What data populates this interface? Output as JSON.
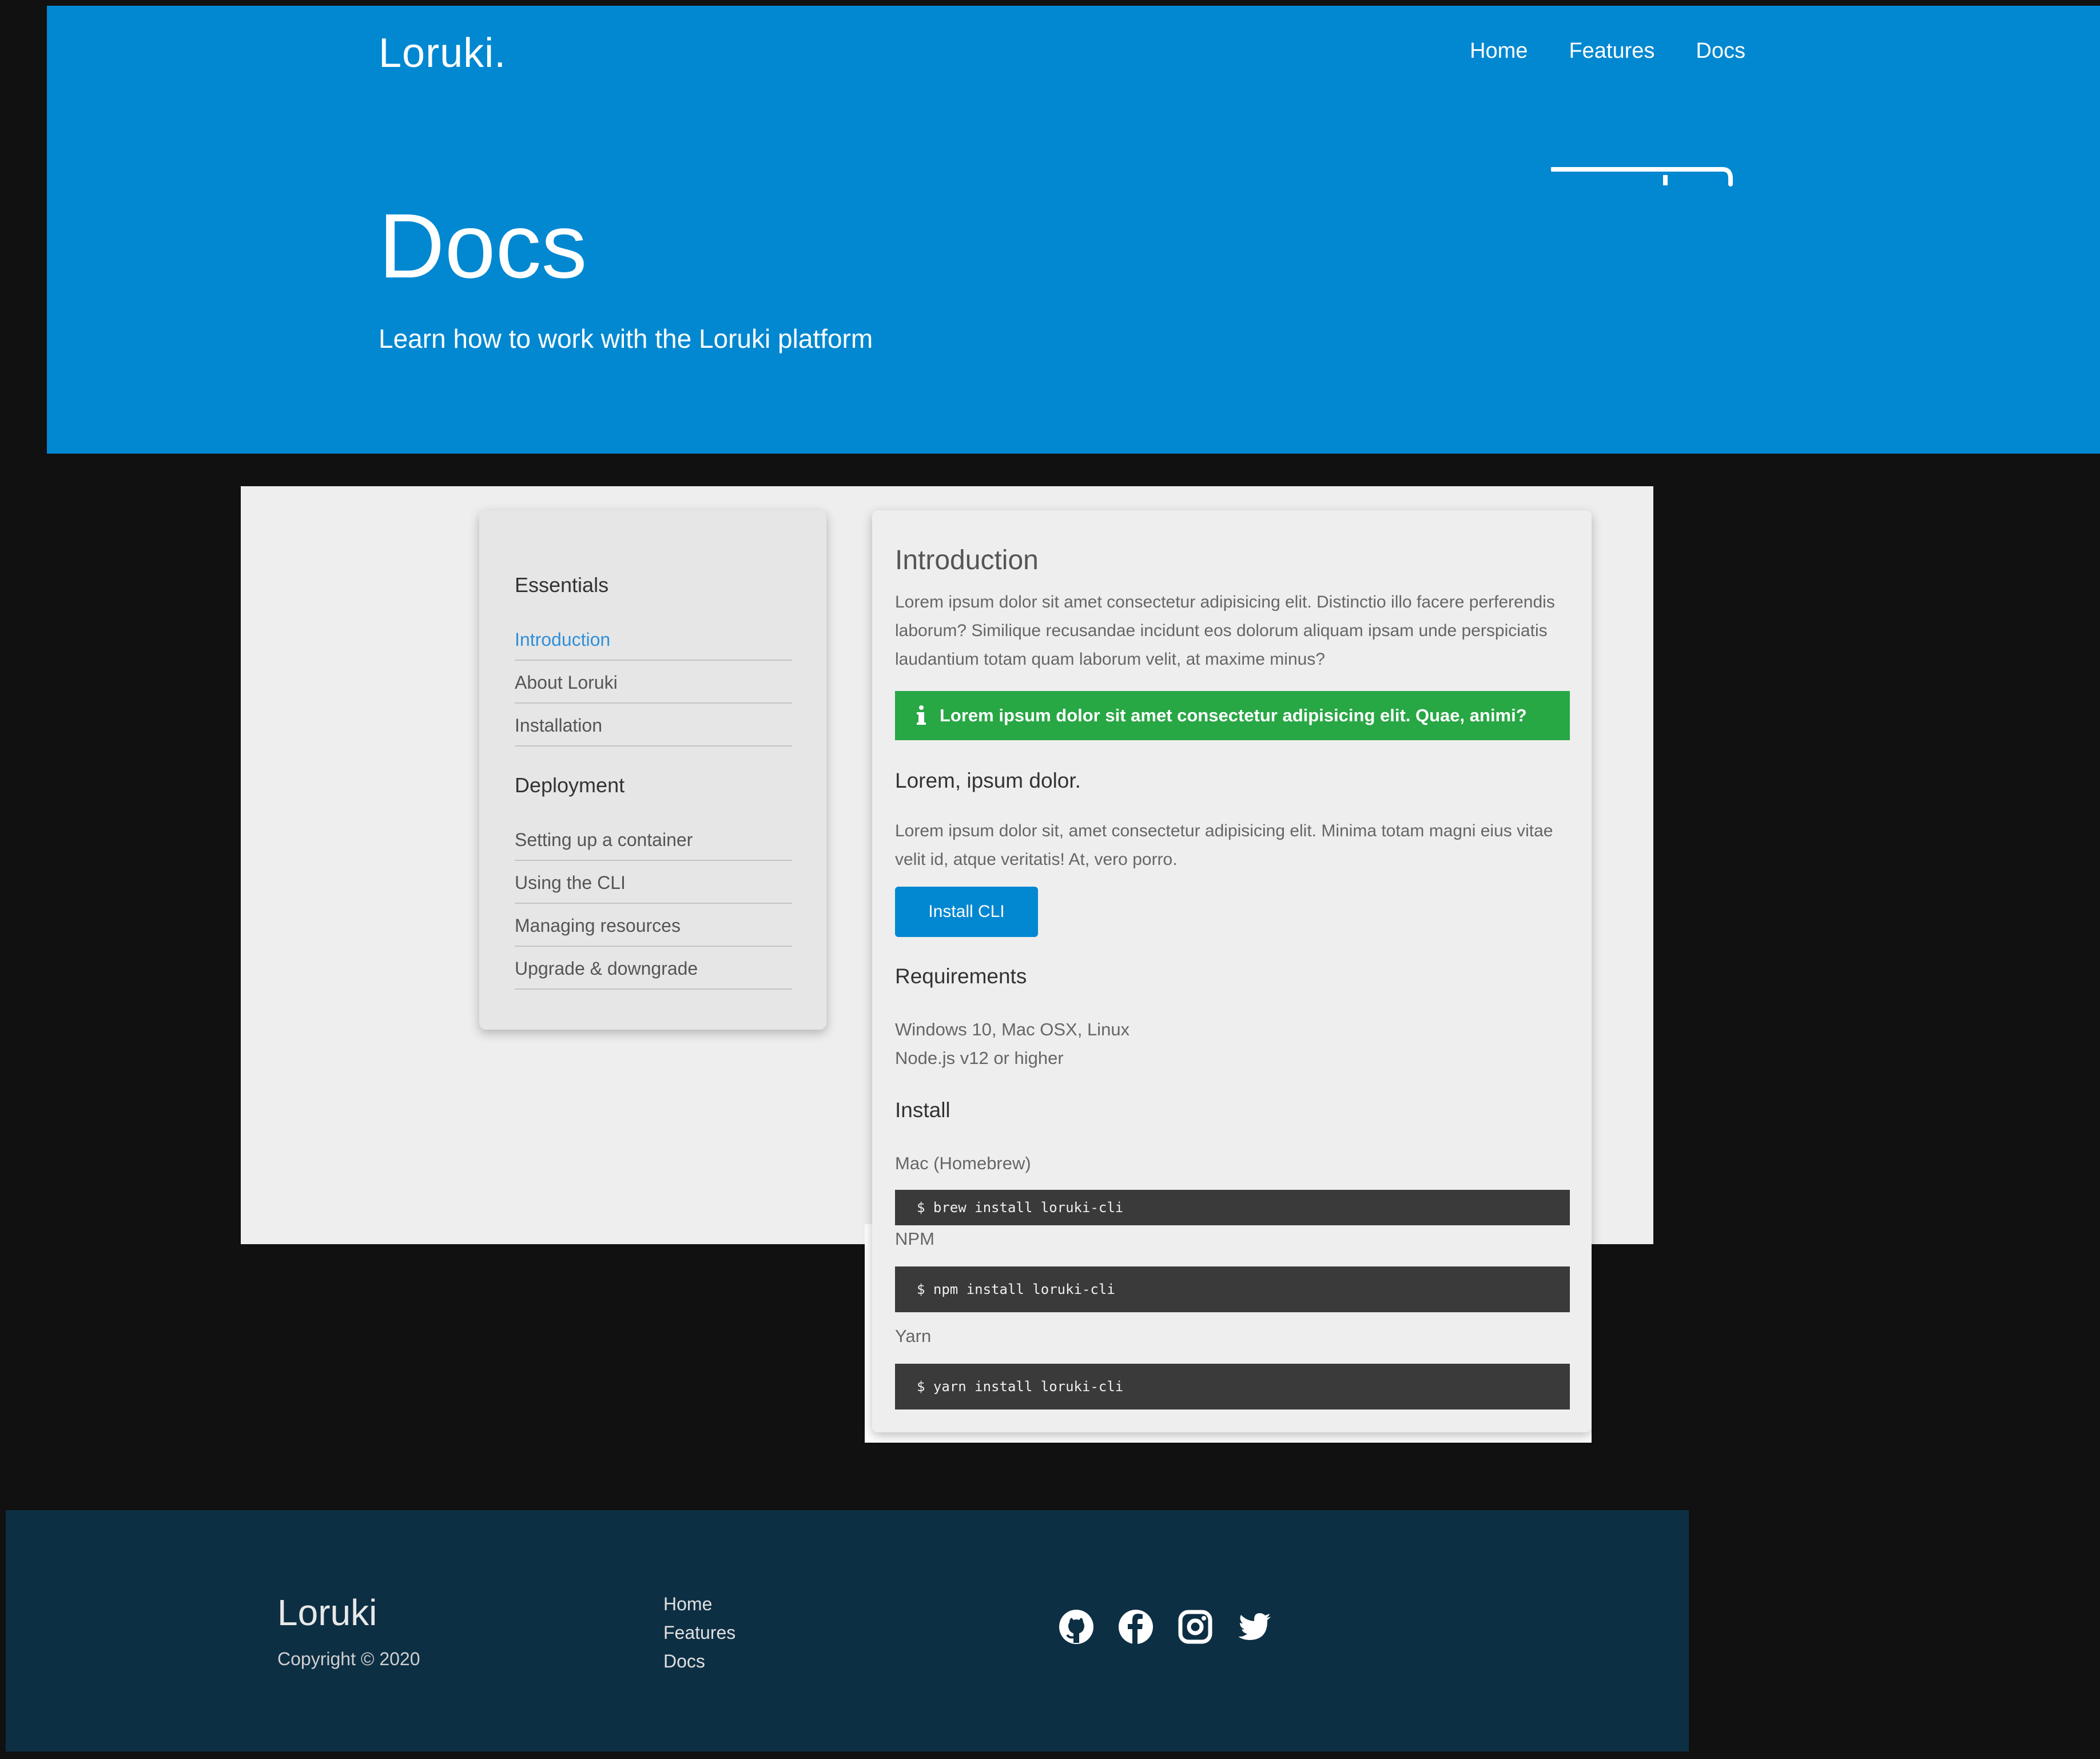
{
  "header": {
    "logo": "Loruki.",
    "nav": [
      "Home",
      "Features",
      "Docs"
    ]
  },
  "hero": {
    "title": "Docs",
    "subtitle": "Learn how to work with the Loruki platform"
  },
  "sidebar": {
    "sections": [
      {
        "heading": "Essentials",
        "items": [
          "Introduction",
          "About Loruki",
          "Installation"
        ]
      },
      {
        "heading": "Deployment",
        "items": [
          "Setting up a container",
          "Using the CLI",
          "Managing resources",
          "Upgrade & downgrade"
        ]
      }
    ],
    "active_item": "Introduction"
  },
  "content": {
    "title": "Introduction",
    "intro_lines": [
      "Lorem ipsum dolor sit amet consectetur adipisicing elit. Distinctio illo facere perferendis",
      "laborum? Similique recusandae incidunt eos dolorum aliquam ipsam unde perspiciatis",
      "laudantium totam quam laborum velit, at maxime minus?"
    ],
    "alert": "Lorem ipsum dolor sit amet consectetur adipisicing elit. Quae, animi?",
    "subheading": "Lorem, ipsum dolor.",
    "sub_lines": [
      "Lorem ipsum dolor sit, amet consectetur adipisicing elit. Minima totam magni eius vitae",
      "velit id, atque veritatis! At, vero porro."
    ],
    "button": "Install CLI",
    "requirements_heading": "Requirements",
    "requirements": [
      "Windows 10, Mac OSX, Linux",
      "Node.js v12 or higher"
    ],
    "install_heading": "Install",
    "install": [
      {
        "label": "Mac (Homebrew)",
        "command": "$ brew install loruki-cli"
      },
      {
        "label": "NPM",
        "command": "$ npm install loruki-cli"
      },
      {
        "label": "Yarn",
        "command": "$ yarn install loruki-cli"
      }
    ]
  },
  "footer": {
    "logo": "Loruki",
    "copyright": "Copyright © 2020",
    "links": [
      "Home",
      "Features",
      "Docs"
    ],
    "social_icons": [
      "github-icon",
      "facebook-icon",
      "instagram-icon",
      "twitter-icon"
    ]
  },
  "colors": {
    "primary": "#0288d1",
    "alert_green": "#28a745",
    "footer_bg": "#0d2f44",
    "page_bg": "#111111"
  }
}
